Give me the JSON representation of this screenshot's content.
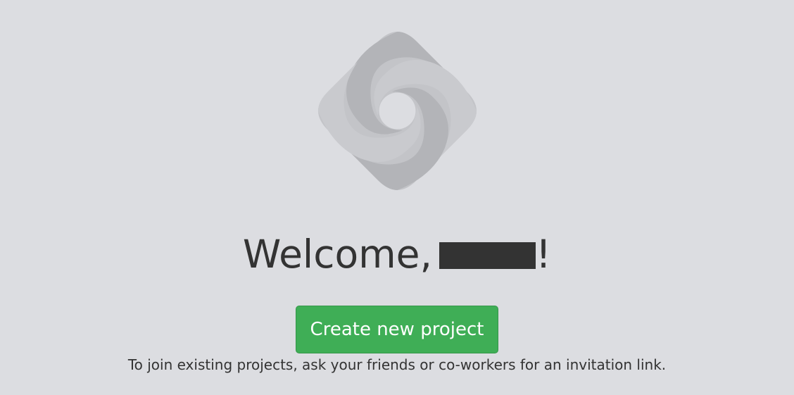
{
  "logo": {
    "icon": "app-logo-icon",
    "colors": {
      "dark": "#b2b3b7",
      "light": "#c8c9cd"
    }
  },
  "welcome": {
    "prefix": "Welcome,",
    "suffix": "!"
  },
  "create_button": {
    "label": "Create new project",
    "color": "#3fae56"
  },
  "hint": {
    "text": "To join existing projects, ask your friends or co-workers for an invitation link."
  }
}
